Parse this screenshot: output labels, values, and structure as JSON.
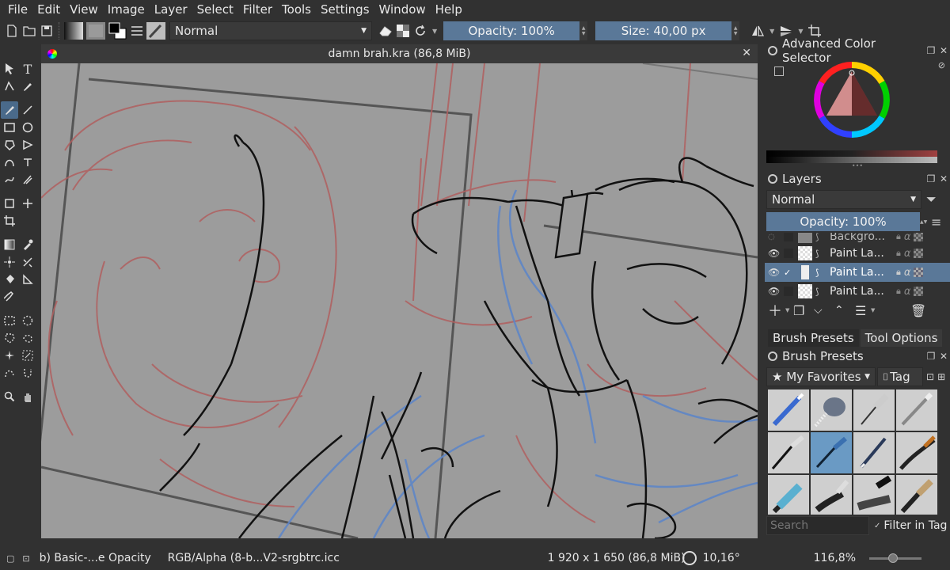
{
  "menu": [
    "File",
    "Edit",
    "View",
    "Image",
    "Layer",
    "Select",
    "Filter",
    "Tools",
    "Settings",
    "Window",
    "Help"
  ],
  "toolbar": {
    "blend_mode": "Normal",
    "opacity_label": "Opacity: 100%",
    "size_label": "Size: 40,00 px"
  },
  "document": {
    "title": "damn brah.kra (86,8 MiB)"
  },
  "color_selector": {
    "title": "Advanced Color Selector"
  },
  "layers": {
    "title": "Layers",
    "blend_mode": "Normal",
    "opacity_label": "Opacity:  100%",
    "items": [
      {
        "name": "Backgro...",
        "visible": false,
        "selected": false
      },
      {
        "name": "Paint La...",
        "visible": true,
        "selected": false
      },
      {
        "name": "Paint La...",
        "visible": true,
        "selected": true
      },
      {
        "name": "Paint La...",
        "visible": true,
        "selected": false
      }
    ]
  },
  "dock_tabs": {
    "brush_presets": "Brush Presets",
    "tool_options": "Tool Options"
  },
  "brush_presets": {
    "title": "Brush Presets",
    "tag_filter": "My Favorites",
    "tag_button": "Tag",
    "search_placeholder": "Search",
    "filter_in_tag": "Filter in Tag"
  },
  "status": {
    "brush": "b) Basic-...e Opacity",
    "color_profile": "RGB/Alpha (8-b...V2-srgbtrc.icc",
    "dimensions": "1 920 x 1 650 (86,8 MiB)",
    "rotation": "10,16°",
    "zoom": "116,8%"
  },
  "colors": {
    "accent": "#5a7898",
    "panel": "#313131",
    "canvas": "#9c9c9c"
  }
}
